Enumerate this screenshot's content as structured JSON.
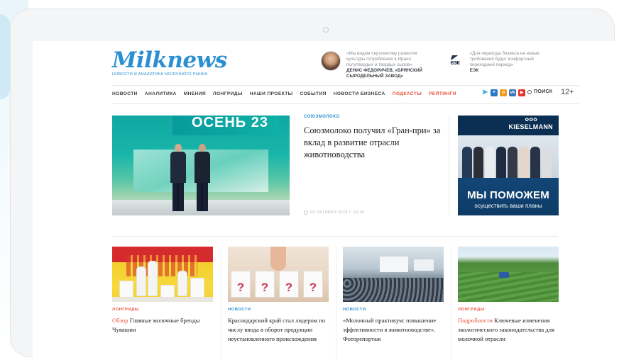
{
  "device": {
    "camera_glyph": "©"
  },
  "logo": {
    "name": "Milknews",
    "tagline": "НОВОСТИ И АНАЛИТИКА МОЛОЧНОГО РЫНКА"
  },
  "quotes": [
    {
      "text": "«Мы видим перспективу развития культуры потребления в Иране полутвердых и твердых сыров»",
      "author_line1": "ДЕНИС ФЕДОРИЧЕВ, «БРЯНСКИЙ",
      "author_line2": "СЫРОДЕЛЬНЫЙ ЗАВОД»"
    },
    {
      "text": "«Для перехода бизнеса на новые требования будет конфортный переходный период»",
      "author": "ЕЭК",
      "logo_text": "еэк"
    }
  ],
  "nav": {
    "items": [
      "НОВОСТИ",
      "АНАЛИТИКА",
      "МНЕНИЯ",
      "ЛОНГРИДЫ",
      "НАШИ ПРОЕКТЫ",
      "СОБЫТИЯ",
      "НОВОСТИ БИЗНЕСА",
      "ПОДКАСТЫ",
      "РЕЙТИНГИ"
    ],
    "highlighted": [
      "ПОДКАСТЫ",
      "РЕЙТИНГИ"
    ],
    "search_label": "ПОИСК",
    "age": "12+"
  },
  "socials": [
    {
      "name": "telegram-icon",
      "color": "#2ea6d9"
    },
    {
      "name": "plus-icon",
      "color": "#2c78c8"
    },
    {
      "name": "odnoklassniki-icon",
      "color": "#f39a1d"
    },
    {
      "name": "vk-icon",
      "color": "#3c74b8"
    },
    {
      "name": "youtube-icon",
      "color": "#e5352c"
    }
  ],
  "hero": {
    "image_banner": "ОСЕНЬ 23",
    "tag": "СОЮЗМОЛОКО",
    "title": "Союзмолоко получил «Гран-при» за вклад в развитие отрасли животноводства",
    "date": "06 ОКТЯБРЯ 2023 Г. 16:35"
  },
  "ad": {
    "brand": "KIESELMANN",
    "headline": "МЫ ПОМОЖЕМ",
    "subline": "осуществить ваши планы"
  },
  "cards": [
    {
      "tag": "ЛОНГРИДЫ",
      "highlight": "Обзор",
      "title": "Главные молочные бренды Чувашии"
    },
    {
      "tag": "НОВОСТИ",
      "highlight": "",
      "title": "Краснодарский край стал лидером по числу ввода в оборот продукции неустановленного происхождения"
    },
    {
      "tag": "НОВОСТИ",
      "highlight": "",
      "title": "«Молочный практикум: повышение эффективности в животноводстве». Фоторепортаж"
    },
    {
      "tag": "ЛОНГРИДЫ",
      "highlight": "Подробности",
      "title": "Ключевые изменения экологического законодательства для молочной отрасли"
    }
  ],
  "colors": {
    "brand_blue": "#2b8fd2",
    "accent_red": "#e8533f"
  }
}
